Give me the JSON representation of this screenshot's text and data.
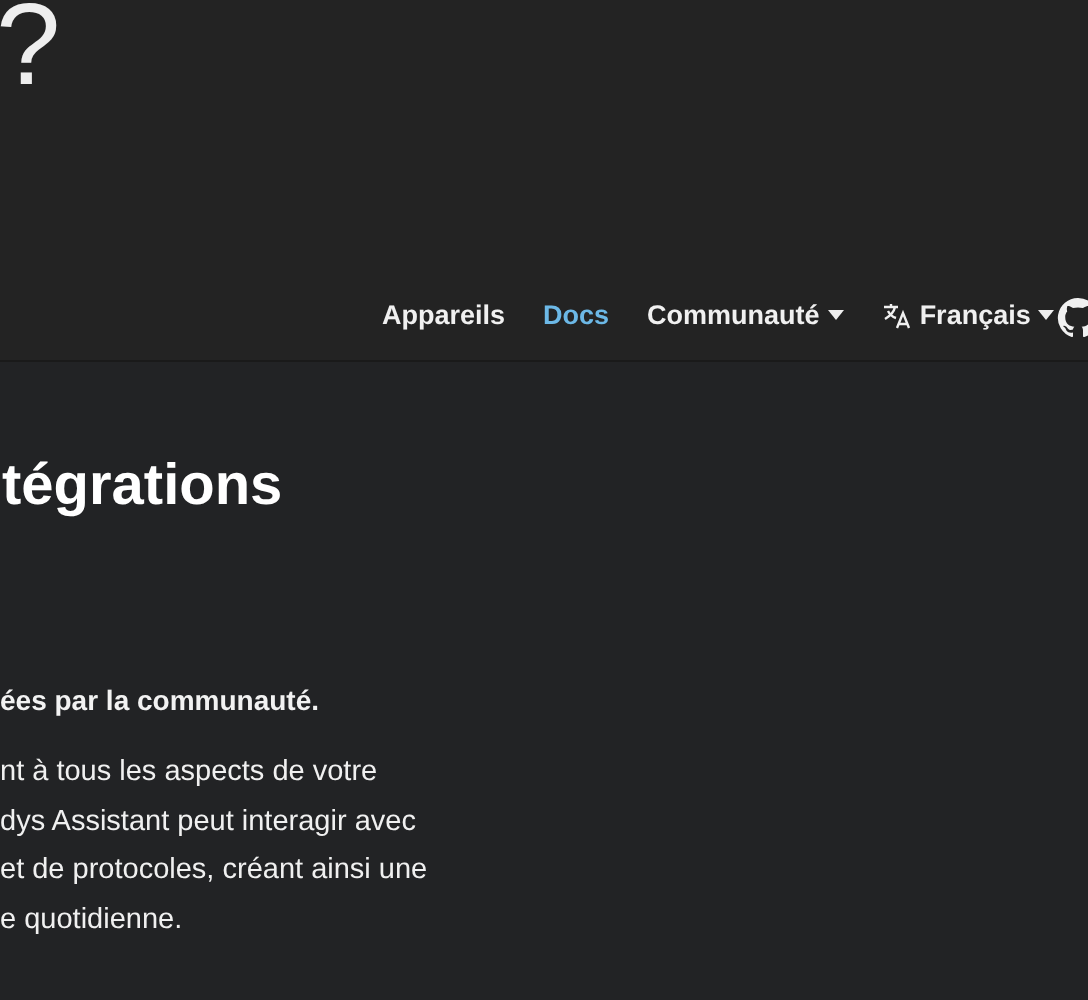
{
  "logo": {
    "text": "?"
  },
  "nav": {
    "items": [
      {
        "label": "Appareils",
        "selected": false,
        "dropdown": false
      },
      {
        "label": "Docs",
        "selected": true,
        "dropdown": false
      },
      {
        "label": "Communauté",
        "selected": false,
        "dropdown": true
      }
    ],
    "language": {
      "label": "Français"
    }
  },
  "heading": "tégrations",
  "lead": "ées par la communauté.",
  "paragraph": [
    "nt à tous les aspects de votre",
    "dys Assistant peut interagir avec",
    "et de protocoles, créant ainsi une",
    "e quotidienne."
  ]
}
